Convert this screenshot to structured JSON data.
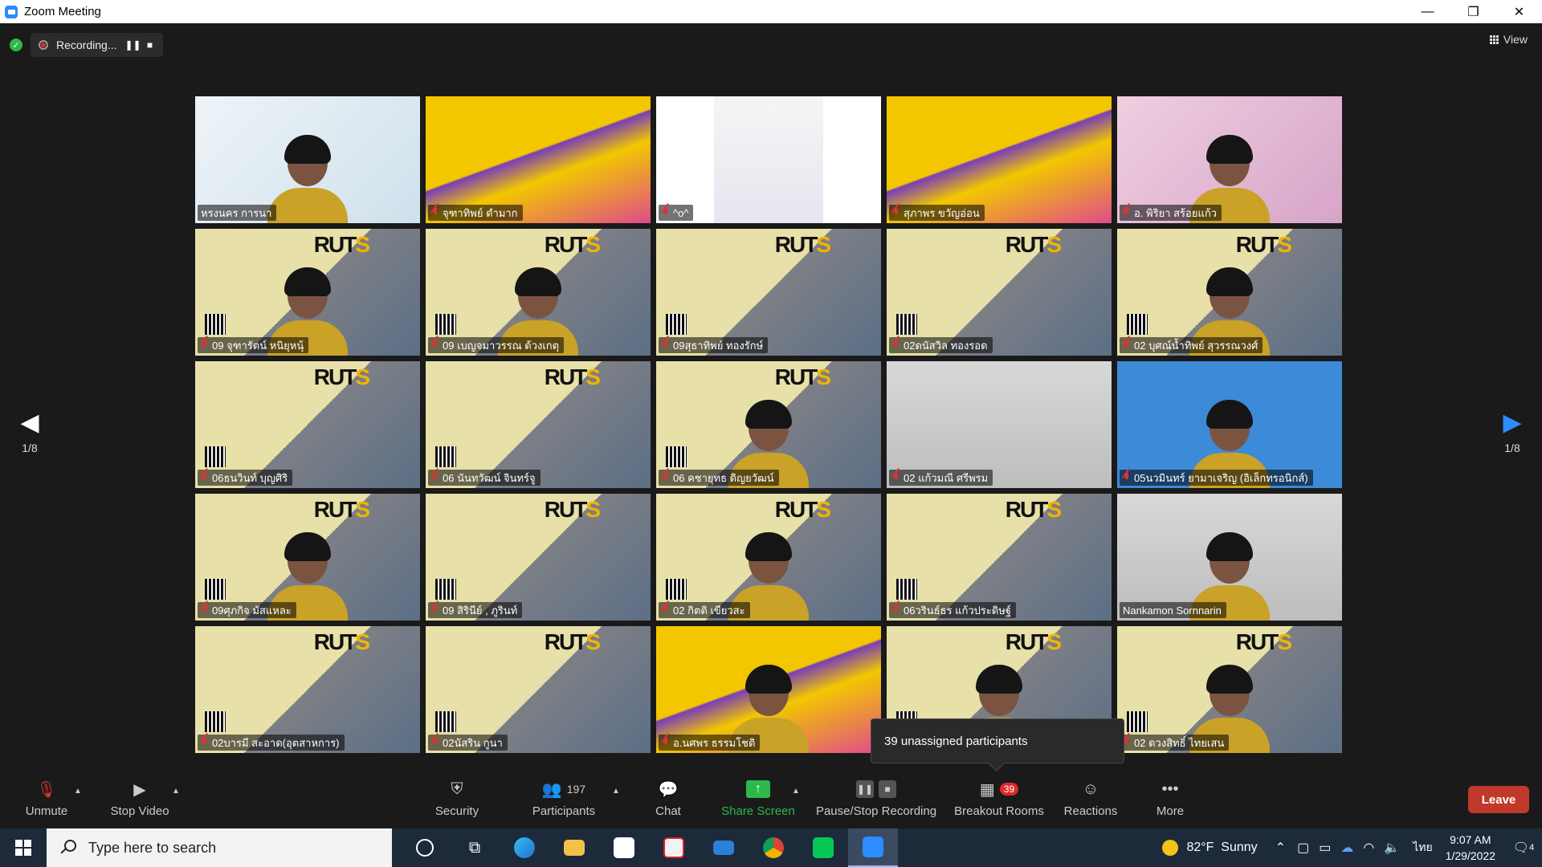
{
  "window": {
    "title": "Zoom Meeting",
    "minimize": "—",
    "restore": "❐",
    "close": "✕"
  },
  "recording": {
    "status": "Recording...",
    "pause": "❚❚",
    "stop": "■"
  },
  "view": {
    "label": "View"
  },
  "pagination": {
    "left": "1/8",
    "right": "1/8",
    "prev_arrow": "◀",
    "next_arrow": "▶"
  },
  "tiles": [
    {
      "name": "หรงนคร การนา",
      "bg": "light",
      "person": true,
      "active": true,
      "muted": false
    },
    {
      "name": "จุฑาทิพย์ ดำมาก",
      "bg": "yellow",
      "person": false,
      "muted": true
    },
    {
      "name": "^o^",
      "bg": "white",
      "person": false,
      "muted": true
    },
    {
      "name": "สุภาพร ขวัญอ่อน",
      "bg": "yellow",
      "person": false,
      "muted": true
    },
    {
      "name": "อ. พิริยา สร้อยแก้ว",
      "bg": "pink",
      "person": true,
      "muted": true
    },
    {
      "name": "09 จุฑารัตน์ หนิยุหนุ้",
      "bg": "slide",
      "person": true,
      "muted": true
    },
    {
      "name": "09 เบญจมาวรรณ ด้วงเกตุ",
      "bg": "slide",
      "person": true,
      "muted": true
    },
    {
      "name": "09สุธาทิพย์ ทองรักษ์",
      "bg": "slide",
      "person": false,
      "muted": true
    },
    {
      "name": "02ดนัสวิล ทองรอด",
      "bg": "slide",
      "person": false,
      "muted": true
    },
    {
      "name": "02 บุศณ์น้ำทิพย์ สุวรรณวงศ์",
      "bg": "slide",
      "person": true,
      "muted": true
    },
    {
      "name": "06ธนวินท์ บุญศิริ",
      "bg": "slide",
      "person": false,
      "muted": true
    },
    {
      "name": "06 นันทวัฒน์ จินทร์จู",
      "bg": "slide",
      "person": false,
      "muted": true
    },
    {
      "name": "06 คชายุทธ ดิญยวัฒน์",
      "bg": "slide",
      "person": true,
      "muted": true
    },
    {
      "name": "02 แก้วมณี ศรีพรม",
      "bg": "room",
      "person": false,
      "muted": true
    },
    {
      "name": "05นวมินทร์ ยามาเจริญ (อิเล็กทรอนิกส์)",
      "bg": "blue",
      "person": true,
      "muted": true
    },
    {
      "name": "09ศุภกิจ มัสแหละ",
      "bg": "slide",
      "person": true,
      "muted": true
    },
    {
      "name": "09 สิรินีย์ , ภูรินท์",
      "bg": "slide",
      "person": false,
      "muted": true
    },
    {
      "name": "02 กิตติ เขียวสะ",
      "bg": "slide",
      "person": true,
      "muted": true
    },
    {
      "name": "06วรินธ์ธร แก้วประดิษฐ์",
      "bg": "slide",
      "person": false,
      "muted": true
    },
    {
      "name": "Nankamon Sornnarin",
      "bg": "room",
      "person": true,
      "muted": false
    },
    {
      "name": "02บารมี สะอาด(อุตสาหการ)",
      "bg": "slide",
      "person": false,
      "muted": true
    },
    {
      "name": "02นัสริน กูนา",
      "bg": "slide",
      "person": false,
      "muted": true
    },
    {
      "name": "อ.นศพร ธรรมโชติ",
      "bg": "yellow",
      "person": true,
      "muted": true
    },
    {
      "name": "",
      "bg": "slide",
      "person": true,
      "muted": false
    },
    {
      "name": "02 ดวงสิทธิ์ ไทยเสน",
      "bg": "slide",
      "person": true,
      "muted": true
    }
  ],
  "tooltip": {
    "text": "39 unassigned participants"
  },
  "toolbar": {
    "unmute": "Unmute",
    "stop_video": "Stop Video",
    "security": "Security",
    "participants": "Participants",
    "participants_count": "197",
    "chat": "Chat",
    "share_screen": "Share Screen",
    "recording": "Pause/Stop Recording",
    "breakout": "Breakout Rooms",
    "breakout_badge": "39",
    "reactions": "Reactions",
    "more": "More",
    "leave": "Leave"
  },
  "taskbar": {
    "search_placeholder": "Type here to search",
    "weather": "82°F  Sunny",
    "lang": "ไทย",
    "time": "9:07 AM",
    "date": "1/29/2022",
    "notif_count": "4"
  },
  "colors": {
    "accent_green": "#2db84c",
    "leave_red": "#c0392b",
    "active_speaker": "#f0ff00"
  }
}
